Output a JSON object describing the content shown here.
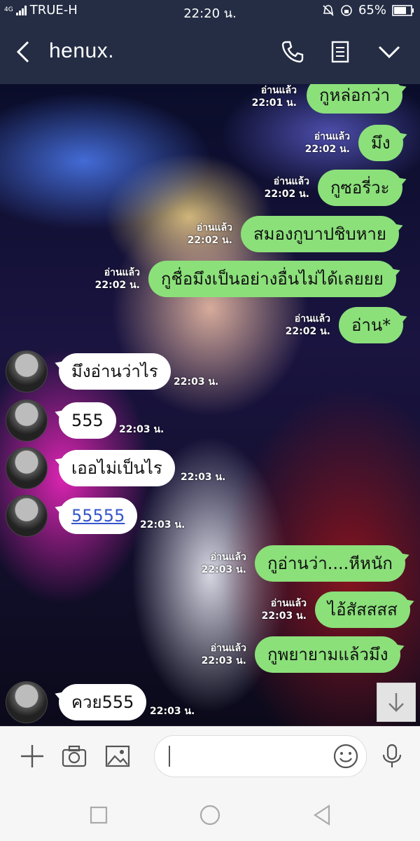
{
  "status": {
    "network": "4G",
    "carrier": "TRUE-H",
    "time": "22:20 น.",
    "battery": "65%"
  },
  "header": {
    "contact_name": "henux."
  },
  "messages": [
    {
      "side": "sent",
      "text": "กูหล่อกว่า",
      "read": "อ่านแล้ว",
      "time": "22:01 น."
    },
    {
      "side": "sent",
      "text": "มึง",
      "read": "อ่านแล้ว",
      "time": "22:02 น."
    },
    {
      "side": "sent",
      "text": "กูซอรี่วะ",
      "read": "อ่านแล้ว",
      "time": "22:02 น."
    },
    {
      "side": "sent",
      "text": "สมองกูบาปชิบหาย",
      "read": "อ่านแล้ว",
      "time": "22:02 น."
    },
    {
      "side": "sent",
      "text": "กูชื่อมึงเป็นอย่างอื่นไม่ได้เลยยย",
      "read": "อ่านแล้ว",
      "time": "22:02 น."
    },
    {
      "side": "sent",
      "text": "อ่าน*",
      "read": "อ่านแล้ว",
      "time": "22:02 น."
    },
    {
      "side": "recv",
      "text": "มึงอ่านว่าไร",
      "time": "22:03 น."
    },
    {
      "side": "recv",
      "text": "555",
      "time": "22:03 น."
    },
    {
      "side": "recv",
      "text": "เออไม่เป็นไร",
      "time": "22:03 น."
    },
    {
      "side": "recv",
      "text": "55555",
      "time": "22:03 น.",
      "link": true
    },
    {
      "side": "sent",
      "text": "กูอ่านว่า....หีหนัก",
      "read": "อ่านแล้ว",
      "time": "22:03 น."
    },
    {
      "side": "sent",
      "text": "ไอ้สัสสสส",
      "read": "อ่านแล้ว",
      "time": "22:03 น."
    },
    {
      "side": "sent",
      "text": "กูพยายามแล้วมึง",
      "read": "อ่านแล้ว",
      "time": "22:03 น."
    },
    {
      "side": "recv",
      "text": "ควย555",
      "time": "22:03 น."
    }
  ],
  "icons": {
    "back": "back-arrow-icon",
    "call": "phone-icon",
    "notes": "note-icon",
    "menu": "chevron-down-icon",
    "scroll": "arrow-down-icon",
    "add": "plus-icon",
    "camera": "camera-icon",
    "gallery": "image-icon",
    "emoji": "smiley-icon",
    "mic": "microphone-icon",
    "recent": "square-icon",
    "home": "circle-icon",
    "back_nav": "triangle-back-icon"
  },
  "colors": {
    "header_bg": "#242d44",
    "sent_bubble": "#8be07a",
    "recv_bubble": "#ffffff"
  }
}
